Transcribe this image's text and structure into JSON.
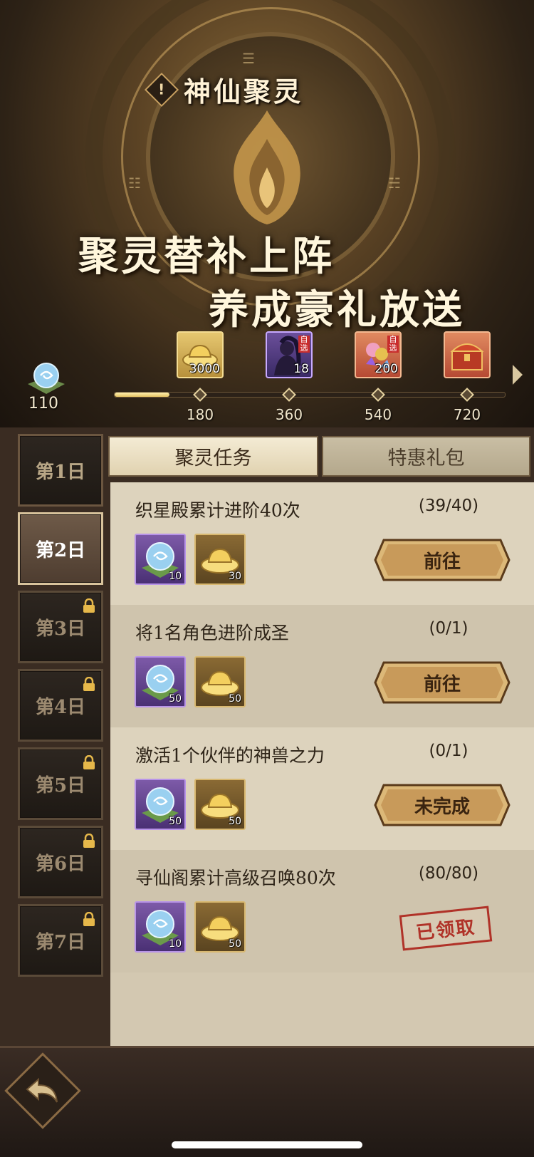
{
  "header": {
    "info_symbol": "!",
    "title": "神仙聚灵",
    "slogan_line1": "聚灵替补上阵",
    "slogan_line2": "养成豪礼放送"
  },
  "progress": {
    "orb_count": "110",
    "fill_fraction": 0.14,
    "rewards": [
      {
        "icon": "gold-ingot-icon",
        "count": "3000",
        "tag": ""
      },
      {
        "icon": "character-portrait-icon",
        "count": "18",
        "tag": "自选"
      },
      {
        "icon": "treasure-pile-icon",
        "count": "200",
        "tag": "自选"
      },
      {
        "icon": "treasure-chest-icon",
        "count": "",
        "tag": ""
      }
    ],
    "milestones": [
      "180",
      "360",
      "540",
      "720"
    ]
  },
  "days": [
    {
      "label": "第1日",
      "state": "unlocked"
    },
    {
      "label": "第2日",
      "state": "active"
    },
    {
      "label": "第3日",
      "state": "locked"
    },
    {
      "label": "第4日",
      "state": "locked"
    },
    {
      "label": "第5日",
      "state": "locked"
    },
    {
      "label": "第6日",
      "state": "locked"
    },
    {
      "label": "第7日",
      "state": "locked"
    }
  ],
  "tabs": {
    "tasks": "聚灵任务",
    "packs": "特惠礼包"
  },
  "tasks": [
    {
      "name": "织星殿累计进阶40次",
      "progress": "(39/40)",
      "orb": "10",
      "ingot": "30",
      "action": "前往"
    },
    {
      "name": "将1名角色进阶成圣",
      "progress": "(0/1)",
      "orb": "50",
      "ingot": "50",
      "action": "前往"
    },
    {
      "name": "激活1个伙伴的神兽之力",
      "progress": "(0/1)",
      "orb": "50",
      "ingot": "50",
      "action": "未完成"
    },
    {
      "name": "寻仙阁累计高级召唤80次",
      "progress": "(80/80)",
      "orb": "10",
      "ingot": "50",
      "action": "已领取"
    }
  ],
  "colors": {
    "accent_gold": "#e5c264",
    "stamp_red": "#b03228",
    "panel_bg": "#d3c8b1"
  }
}
